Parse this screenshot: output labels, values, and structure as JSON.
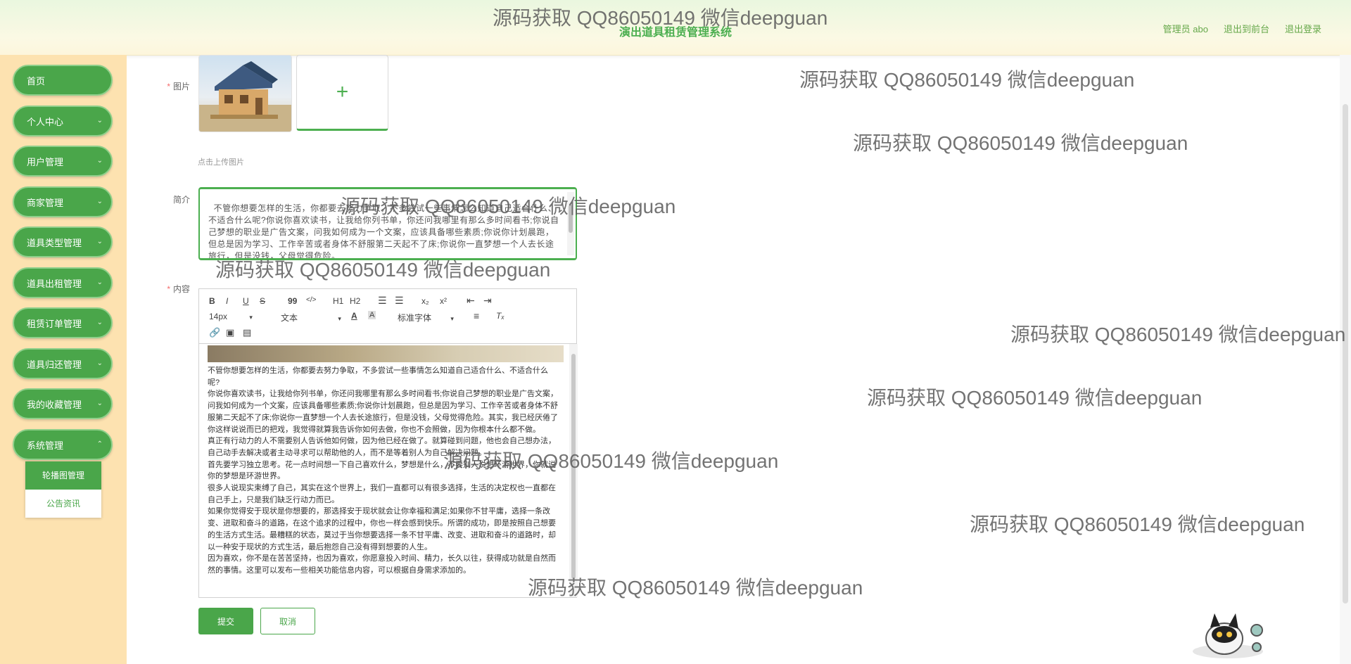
{
  "header": {
    "title": "演出道具租赁管理系统",
    "admin_label": "管理员 abo",
    "back_label": "退出到前台",
    "logout_label": "退出登录"
  },
  "sidebar": {
    "items": [
      {
        "label": "首页"
      },
      {
        "label": "个人中心"
      },
      {
        "label": "用户管理"
      },
      {
        "label": "商家管理"
      },
      {
        "label": "道具类型管理"
      },
      {
        "label": "道具出租管理"
      },
      {
        "label": "租赁订单管理"
      },
      {
        "label": "道具归还管理"
      },
      {
        "label": "我的收藏管理"
      },
      {
        "label": "系统管理"
      }
    ],
    "submenu": [
      {
        "label": "轮播图管理"
      },
      {
        "label": "公告资讯"
      }
    ]
  },
  "form": {
    "image_label": "图片",
    "upload_hint": "点击上传图片",
    "intro_label": "简介",
    "intro_text": "不管你想要怎样的生活，你都要去努力争取，不多尝试一些事情怎么知道自己适合什么、不适合什么呢?你说你喜欢读书，让我给你列书单，你还问我哪里有那么多时间看书;你说自己梦想的职业是广告文案，问我如何成为一个文案，应该具备哪些素质;你说你计划晨跑，但总是因为学习、工作辛苦或者身体不舒服第二天起不了床;你说你一直梦想一个人去长途旅行，但是没钱，父母觉得危险。\n测试",
    "content_label": "内容",
    "content_paragraphs": [
      "不管你想要怎样的生活，你都要去努力争取，不多尝试一些事情怎么知道自己适合什么、不适合什么呢?",
      "你说你喜欢读书，让我给你列书单，你还问我哪里有那么多时间看书;你说自己梦想的职业是广告文案，问我如何成为一个文案，应该具备哪些素质;你说你计划晨跑，但总是因为学习、工作辛苦或者身体不舒服第二天起不了床;你说你一直梦想一个人去长途旅行，但是没钱，父母觉得危险。其实，我已经厌倦了你这样说说而已的把戏，我觉得就算我告诉你如何去做，你也不会照做，因为你根本什么都不做。",
      "真正有行动力的人不需要别人告诉他如何做，因为他已经在做了。就算碰到问题，他也会自己想办法，自己动手去解决或者主动寻求可以帮助他的人，而不是等着别人为自己解决问题。",
      "首先要学习独立思考。花一点时间想一下自己喜欢什么，梦想是什么，不要别人说想环游世界，你就说你的梦想是环游世界。",
      "很多人说现实束缚了自己，其实在这个世界上，我们一直都可以有很多选择，生活的决定权也一直都在自己手上，只是我们缺乏行动力而已。",
      "如果你觉得安于现状是你想要的，那选择安于现状就会让你幸福和满足;如果你不甘平庸，选择一条改变、进取和奋斗的道路，在这个追求的过程中，你也一样会感到快乐。所谓的成功，即是按照自己想要的生活方式生活。最糟糕的状态，莫过于当你想要选择一条不甘平庸、改变、进取和奋斗的道路时，却以一种安于现状的方式生活，最后抱怨自己没有得到想要的人生。",
      "因为喜欢，你不是在苦苦坚持，也因为喜欢，你愿意投入时间、精力，长久以往，获得成功就是自然而然的事情。这里可以发布一些相关功能信息内容，可以根据自身需求添加的。"
    ],
    "toolbar": {
      "bold": "B",
      "italic": "I",
      "underline": "U",
      "strike": "S",
      "quote": "99",
      "code": "</>",
      "h1": "H1",
      "h2": "H2",
      "sub": "x₂",
      "sup": "x²",
      "font_size": "14px",
      "text_type": "文本",
      "font_family": "标准字体"
    },
    "submit_label": "提交",
    "cancel_label": "取消"
  },
  "watermark": "源码获取 QQ86050149 微信deepguan"
}
